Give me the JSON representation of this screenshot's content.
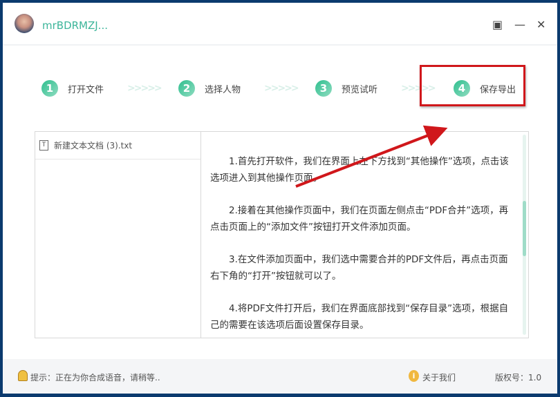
{
  "title": {
    "username": "mrBDRMZJ...",
    "layout_icon": "▣",
    "minimize": "—",
    "close": "✕"
  },
  "steps": [
    {
      "num": "1",
      "label": "打开文件"
    },
    {
      "num": "2",
      "label": "选择人物"
    },
    {
      "num": "3",
      "label": "预览试听"
    },
    {
      "num": "4",
      "label": "保存导出"
    }
  ],
  "step_separator": ">>>>>",
  "files": [
    {
      "name": "新建文本文档 (3).txt"
    }
  ],
  "content": [
    "1.首先打开软件，我们在界面上左下方找到“其他操作”选项，点击该选项进入到其他操作页面。",
    "2.接着在其他操作页面中，我们在页面左侧点击“PDF合并”选项，再点击页面上的“添加文件”按钮打开文件添加页面。",
    "3.在文件添加页面中，我们选中需要合并的PDF文件后，再点击页面右下角的“打开”按钮就可以了。",
    "4.将PDF文件打开后，我们在界面底部找到“保存目录”选项，根据自己的需要在该选项后面设置保存目录。"
  ],
  "footer": {
    "hint": "提示：正在为你合成语音，请稍等..",
    "about": "关于我们",
    "version": "版权号：1.0"
  },
  "colors": {
    "accent": "#3cb59a",
    "highlight": "#d0171b"
  }
}
